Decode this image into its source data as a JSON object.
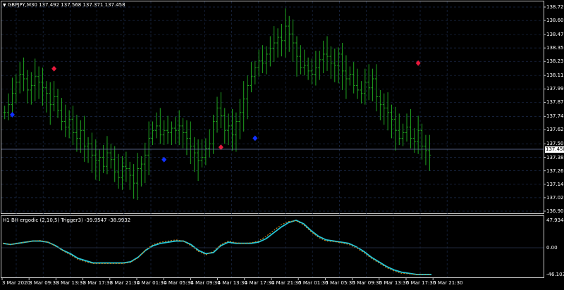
{
  "main_chart": {
    "symbol_header": "GBPJPY,M30  137.492 137.568 137.371 137.458",
    "price_labels": [
      "138.720",
      "138.600",
      "138.475",
      "138.355",
      "138.235",
      "138.110",
      "137.990",
      "137.870",
      "137.745",
      "137.625",
      "137.500",
      "137.380",
      "137.260",
      "137.140",
      "137.020",
      "136.900"
    ],
    "current_price": "137.458",
    "colors": {
      "background": "#000000",
      "bars": "#1fa31f",
      "grid": "#1c2b4a",
      "sell_marker": "#e8193c",
      "buy_marker": "#1030ff",
      "current_price_box": "#ffffff"
    }
  },
  "indicator": {
    "header": "H1 BH ergodic (2,10,5) Trigger3) -39.9547 -38.9932",
    "scale_labels": [
      "47.9344",
      "0.00",
      "-46.1039"
    ],
    "colors": {
      "main_line": "#26c6d6",
      "trigger_line": "#d98a1a"
    }
  },
  "time_axis": {
    "labels": [
      "3 Mar 2020",
      "3 Mar 09:30",
      "3 Mar 13:30",
      "3 Mar 17:30",
      "3 Mar 21:30",
      "4 Mar 01:30",
      "4 Mar 05:30",
      "4 Mar 09:30",
      "4 Mar 13:30",
      "4 Mar 17:30",
      "4 Mar 21:30",
      "5 Mar 01:30",
      "5 Mar 05:30",
      "5 Mar 09:30",
      "5 Mar 13:30",
      "5 Mar 17:30",
      "5 Mar 21:30"
    ]
  },
  "chart_data": {
    "type": "bar",
    "title": "GBPJPY,M30",
    "ylim": [
      136.9,
      138.72
    ],
    "series": [
      {
        "name": "GBPJPY,M30",
        "values_close": [
          137.78,
          137.85,
          137.95,
          138.05,
          138.12,
          138.08,
          137.98,
          138.02,
          138.1,
          138.05,
          138.0,
          137.95,
          137.85,
          137.92,
          137.8,
          137.7,
          137.65,
          137.72,
          137.6,
          137.55,
          137.62,
          137.48,
          137.5,
          137.4,
          137.35,
          137.38,
          137.3,
          137.42,
          137.36,
          137.25,
          137.2,
          137.3,
          137.28,
          137.22,
          137.15,
          137.28,
          137.32,
          137.4,
          137.55,
          137.62,
          137.66,
          137.58,
          137.62,
          137.6,
          137.64,
          137.62,
          137.66,
          137.6,
          137.55,
          137.48,
          137.42,
          137.35,
          137.38,
          137.46,
          137.5,
          137.7,
          137.82,
          137.75,
          137.62,
          137.66,
          137.58,
          137.7,
          137.78,
          137.9,
          138.02,
          138.1,
          138.18,
          138.24,
          138.22,
          138.3,
          138.35,
          138.4,
          138.45,
          138.42,
          138.55,
          138.48,
          138.4,
          138.28,
          138.18,
          138.2,
          138.15,
          138.12,
          138.18,
          138.25,
          138.3,
          138.28,
          138.22,
          138.2,
          138.3,
          138.15,
          138.08,
          138.12,
          138.02,
          137.98,
          137.95,
          138.05,
          138.0,
          138.08,
          137.92,
          137.85,
          137.82,
          137.78,
          137.72,
          137.62,
          137.55,
          137.6,
          137.65,
          137.55,
          137.52,
          137.62,
          137.48,
          137.44,
          137.4
        ]
      }
    ],
    "markers": [
      {
        "type": "buy",
        "bar_index": 2,
        "price": 137.76
      },
      {
        "type": "sell",
        "bar_index": 13,
        "price": 138.17
      },
      {
        "type": "buy",
        "bar_index": 42,
        "price": 137.36
      },
      {
        "type": "sell",
        "bar_index": 57,
        "price": 137.47
      },
      {
        "type": "buy",
        "bar_index": 66,
        "price": 137.55
      },
      {
        "type": "sell",
        "bar_index": 109,
        "price": 138.22
      }
    ],
    "indicator_series": [
      {
        "name": "main",
        "values": [
          8,
          6,
          8,
          10,
          12,
          12,
          10,
          4,
          -4,
          -10,
          -18,
          -22,
          -26,
          -26,
          -26,
          -26,
          -26,
          -24,
          -16,
          -4,
          4,
          8,
          10,
          12,
          12,
          6,
          -4,
          -10,
          -8,
          4,
          10,
          8,
          8,
          8,
          10,
          16,
          26,
          36,
          44,
          48,
          42,
          30,
          20,
          14,
          12,
          10,
          8,
          2,
          -6,
          -16,
          -24,
          -32,
          -38,
          -42,
          -44,
          -46,
          -46,
          -46
        ]
      },
      {
        "name": "trigger",
        "values": [
          8,
          6,
          8,
          10,
          12,
          13,
          10,
          3,
          -5,
          -12,
          -20,
          -24,
          -27,
          -27,
          -27,
          -27,
          -27,
          -25,
          -17,
          -3,
          6,
          10,
          12,
          14,
          12,
          4,
          -6,
          -12,
          -6,
          6,
          12,
          9,
          8,
          9,
          12,
          20,
          30,
          40,
          46,
          47,
          40,
          28,
          18,
          12,
          11,
          9,
          6,
          0,
          -8,
          -18,
          -26,
          -34,
          -40,
          -44,
          -45,
          -46,
          -46,
          -46
        ]
      }
    ]
  }
}
